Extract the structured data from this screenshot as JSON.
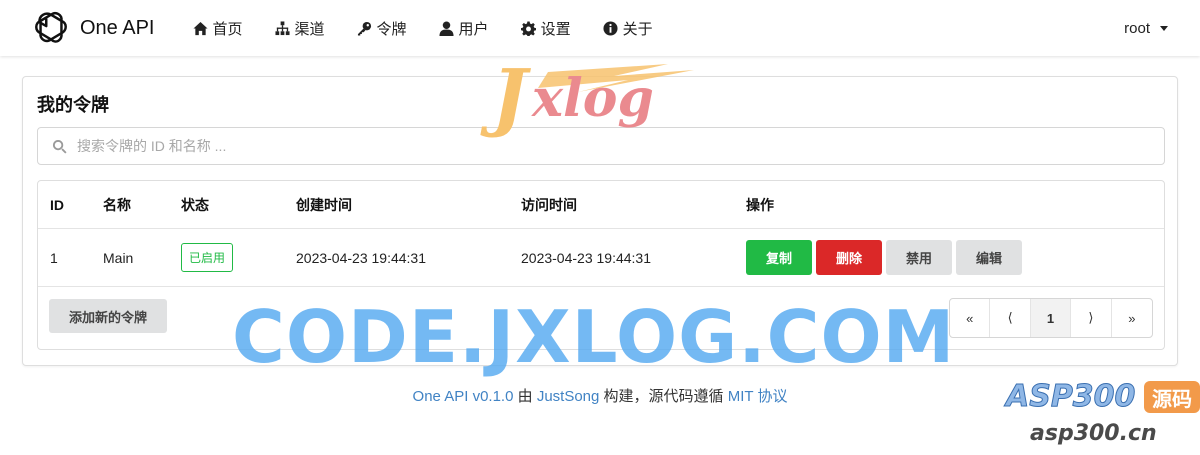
{
  "app": {
    "name": "One API"
  },
  "nav": {
    "items": [
      {
        "label": "首页",
        "icon": "home-icon"
      },
      {
        "label": "渠道",
        "icon": "sitemap-icon"
      },
      {
        "label": "令牌",
        "icon": "key-icon"
      },
      {
        "label": "用户",
        "icon": "user-icon"
      },
      {
        "label": "设置",
        "icon": "gear-icon"
      },
      {
        "label": "关于",
        "icon": "info-icon"
      }
    ],
    "user": "root"
  },
  "tokens": {
    "title": "我的令牌",
    "search": {
      "placeholder": "搜索令牌的 ID 和名称 ...",
      "value": ""
    },
    "columns": [
      "ID",
      "名称",
      "状态",
      "创建时间",
      "访问时间",
      "操作"
    ],
    "rows": [
      {
        "id": "1",
        "name": "Main",
        "status": "已启用",
        "created": "2023-04-23 19:44:31",
        "accessed": "2023-04-23 19:44:31",
        "actions": {
          "copy": "复制",
          "delete": "删除",
          "disable": "禁用",
          "edit": "编辑"
        }
      }
    ],
    "add_label": "添加新的令牌",
    "pagination": {
      "first": "«",
      "prev": "⟨",
      "current": "1",
      "next": "⟩",
      "last": "»"
    }
  },
  "footer": {
    "version": "One API v0.1.0",
    "by": "由",
    "author": "JustSong",
    "built": "构建，源代码遵循",
    "license": "MIT 协议"
  },
  "watermarks": {
    "jxlog_j": "J",
    "jxlog_rest": "xlog",
    "code": "CODE.JXLOG.COM",
    "asp": "ASP300",
    "asp_badge": "源码",
    "asp_domain": "asp300.cn"
  },
  "colors": {
    "success": "#21ba45",
    "danger": "#db2828",
    "link": "#4183c4"
  }
}
